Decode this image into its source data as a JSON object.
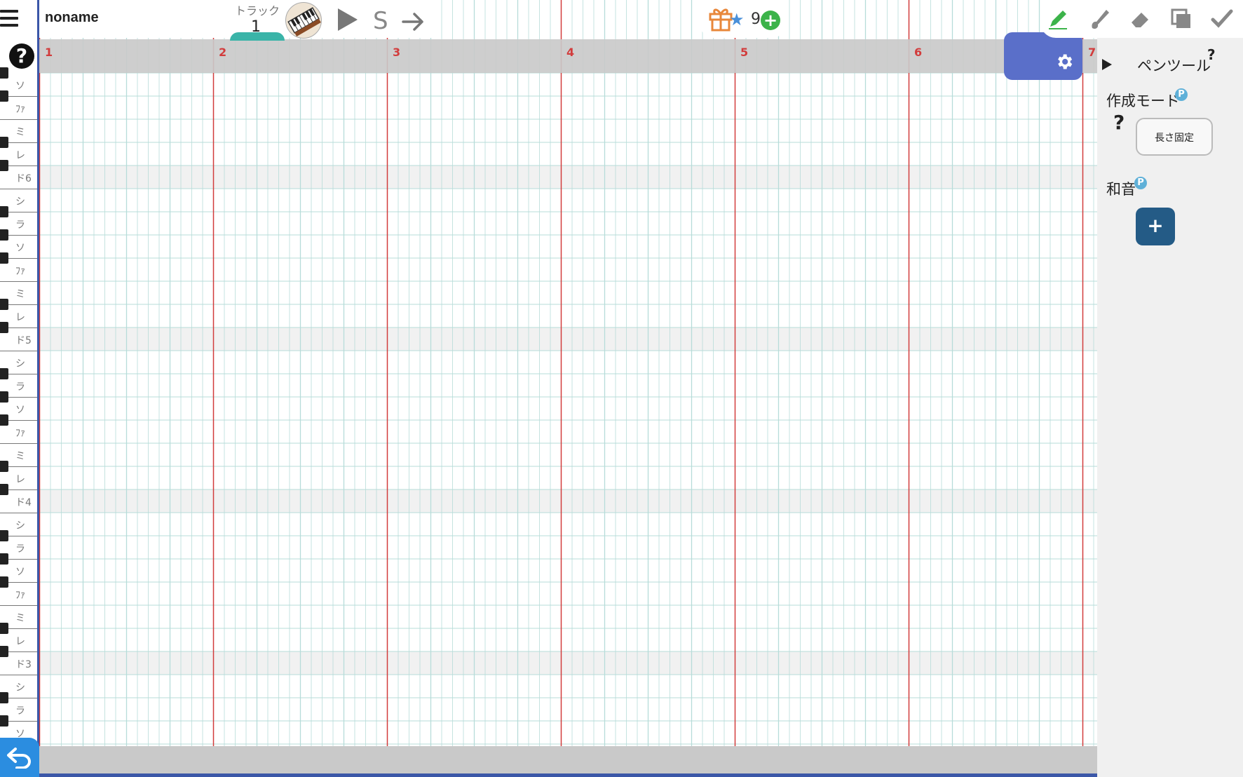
{
  "app": {
    "title": "noname",
    "track_label": "トラック",
    "track_number": "1",
    "s_button": "S",
    "star_count": "9"
  },
  "ruler": {
    "measures": [
      "1",
      "2",
      "3",
      "4",
      "5",
      "6",
      "7"
    ]
  },
  "piano": {
    "labels": [
      "ソ",
      "ﾌｧ",
      "ミ",
      "レ",
      "ド6",
      "シ",
      "ラ",
      "ソ",
      "ﾌｧ",
      "ミ",
      "レ",
      "ド5",
      "シ",
      "ラ",
      "ソ",
      "ﾌｧ",
      "ミ",
      "レ",
      "ド4",
      "シ",
      "ラ",
      "ソ",
      "ﾌｧ",
      "ミ",
      "レ",
      "ド3",
      "シ",
      "ラ",
      "ソ"
    ]
  },
  "panel": {
    "tool_name": "ペンツール",
    "mode_label": "作成モード",
    "length_button": "長さ固定",
    "chord_label": "和音",
    "chord_add": "+",
    "help_mark": "?",
    "premium_badge": "P"
  },
  "colors": {
    "measure_line": "#d23c3c",
    "grid_line": "#b7dcd9",
    "ruler_bg": "#c9c9c9",
    "octave_band": "#f1f1f1",
    "settings_btn": "#5a6fc9",
    "chord_btn": "#245b86",
    "back_btn": "#2b8de0",
    "track_tab": "#3ab4a8",
    "add_star": "#3cb34a",
    "pen_active": "#3cb34a"
  },
  "icons": [
    "menu-icon",
    "help-icon",
    "piano-icon",
    "play-icon",
    "next-icon",
    "gift-icon",
    "star-icon",
    "plus-icon",
    "pen-icon",
    "brush-icon",
    "eraser-icon",
    "copy-icon",
    "check-icon",
    "gear-icon",
    "back-icon"
  ]
}
